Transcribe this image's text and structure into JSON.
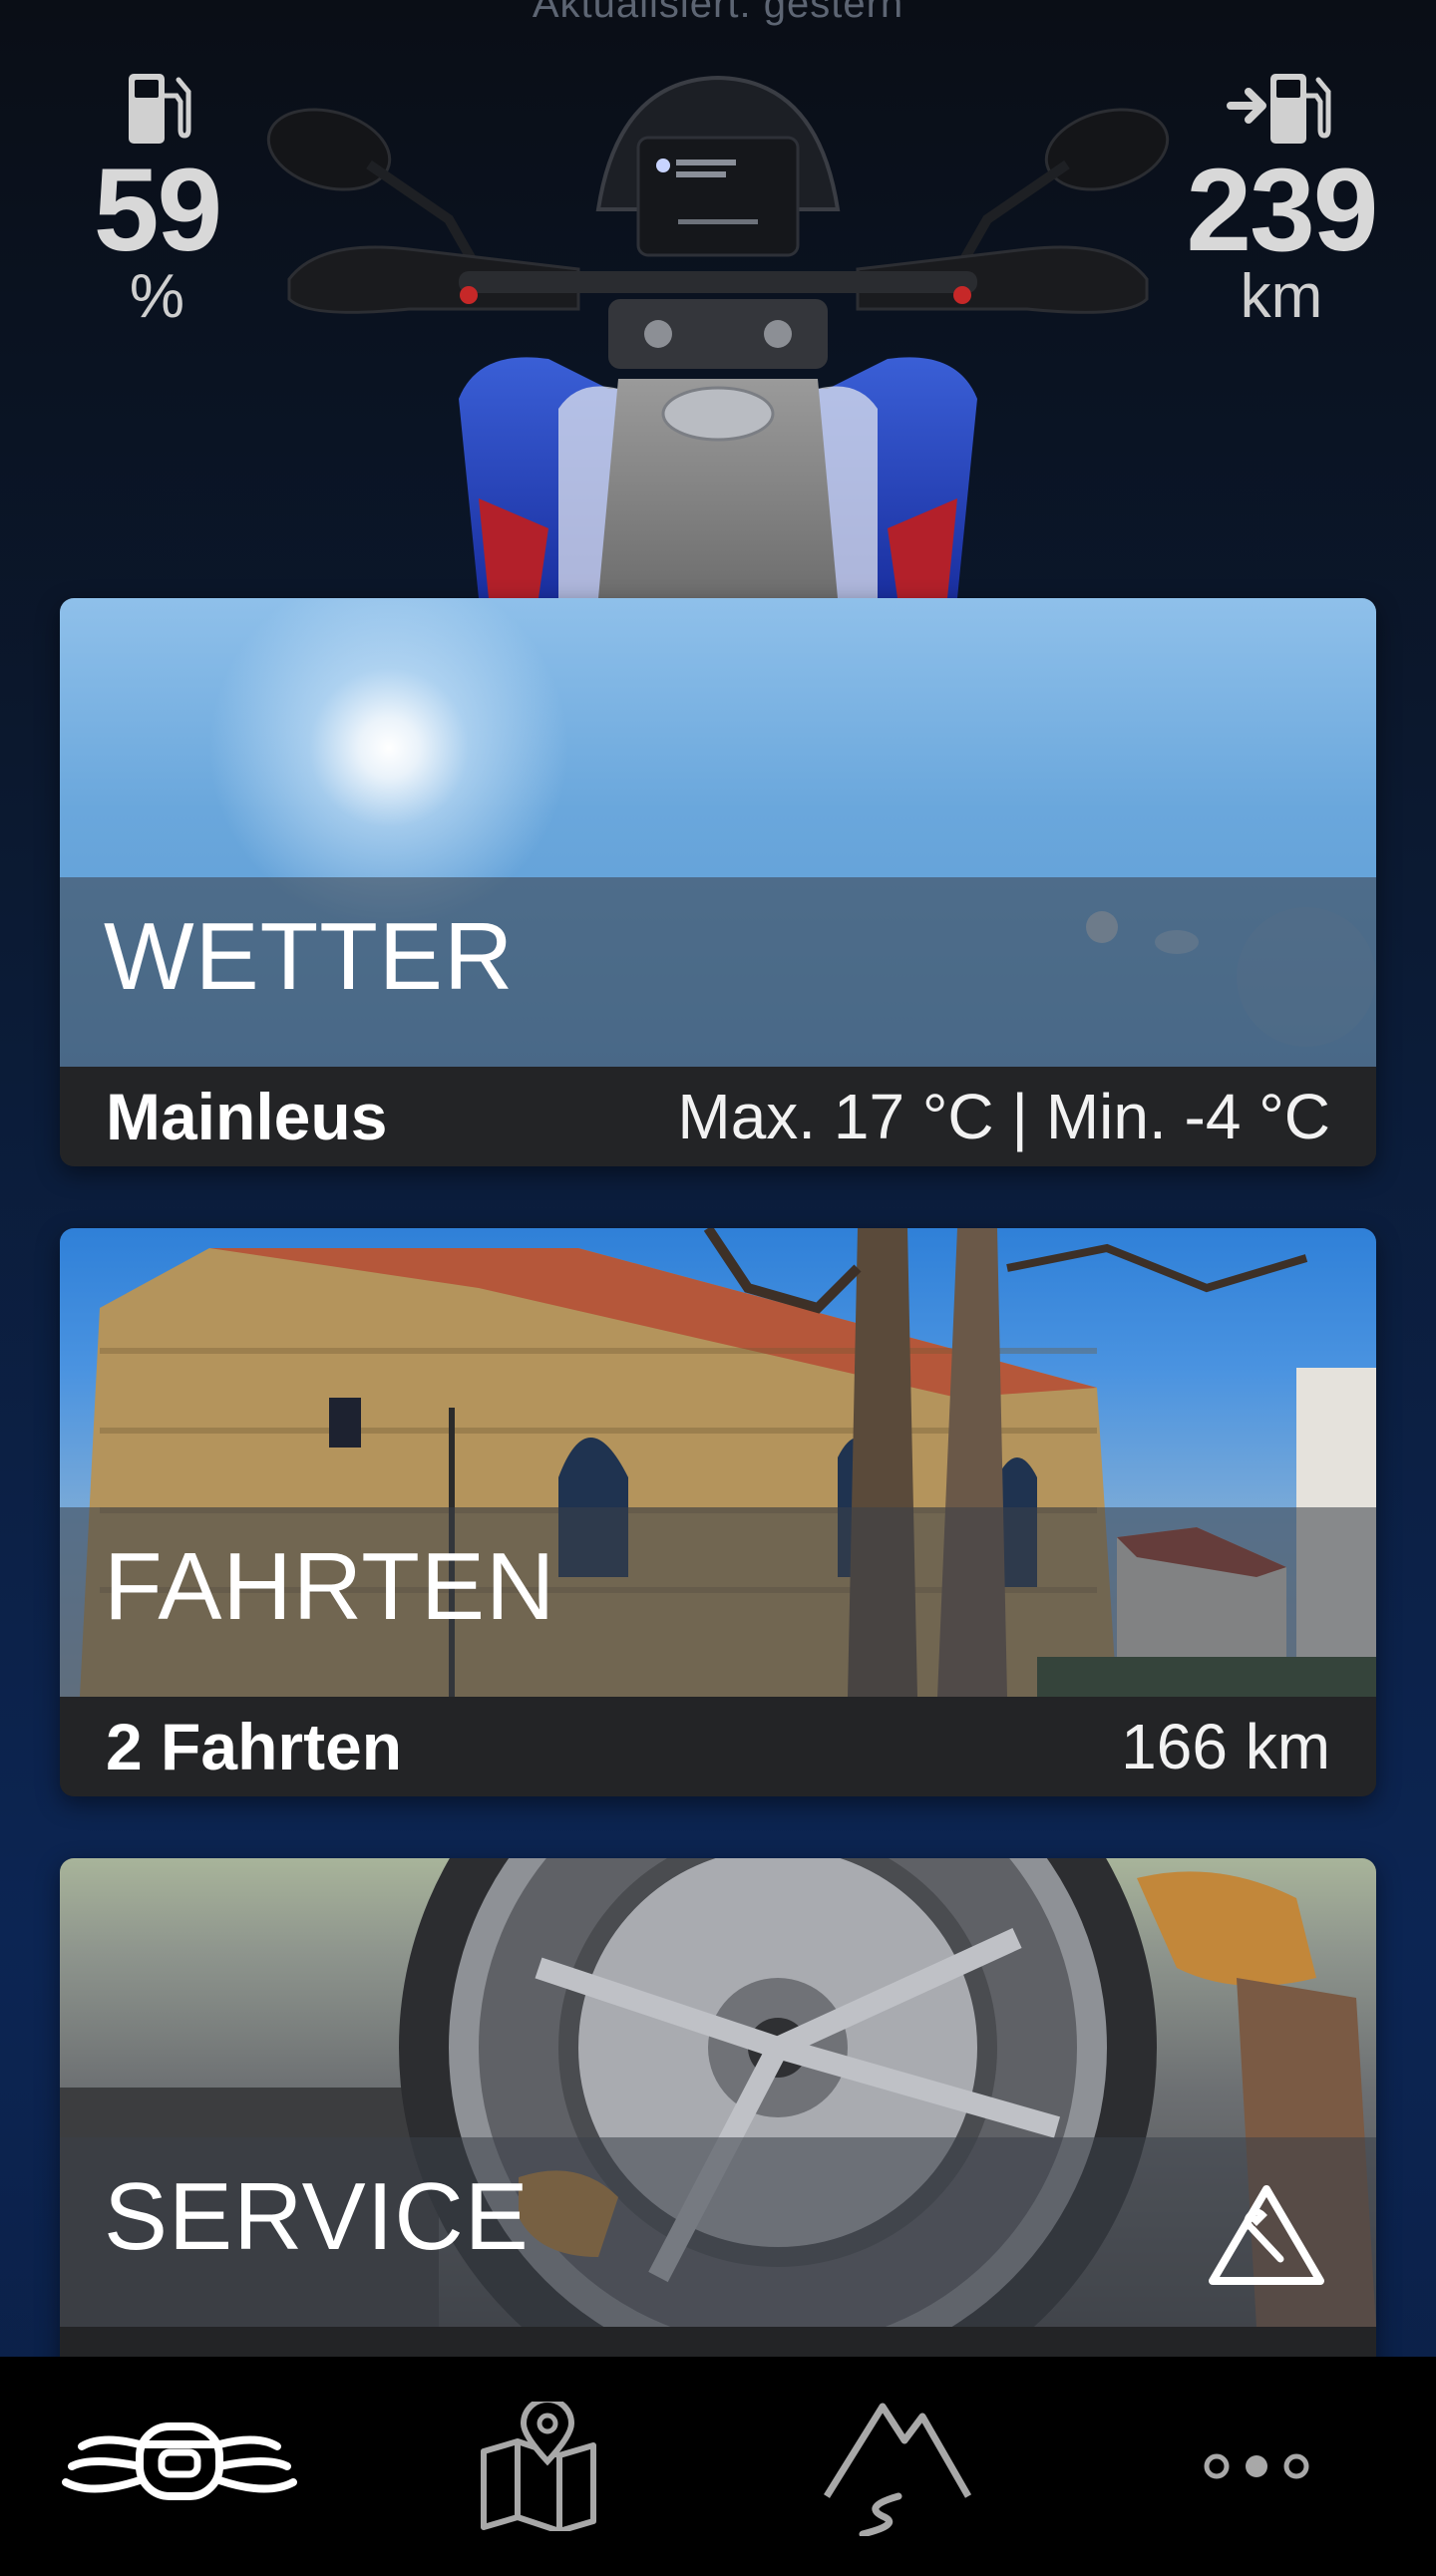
{
  "header": {
    "updated_text": "Aktualisiert: gestern"
  },
  "fuel": {
    "icon": "fuel-pump-icon",
    "value": "59",
    "unit": "%"
  },
  "range": {
    "icon": "fuel-range-icon",
    "value": "239",
    "unit": "km"
  },
  "cards": {
    "weather": {
      "title": "WETTER",
      "location": "Mainleus",
      "temps": "Max. 17 °C | Min. -4 °C"
    },
    "trips": {
      "title": "FAHRTEN",
      "count": "2 Fahrten",
      "distance": "166 km"
    },
    "service": {
      "title": "SERVICE",
      "icon": "service-warning-icon"
    }
  },
  "nav": {
    "items": [
      {
        "name": "vehicle",
        "icon": "motorcycle-handlebar-icon",
        "active": true
      },
      {
        "name": "map",
        "icon": "map-pin-icon",
        "active": false
      },
      {
        "name": "routes",
        "icon": "mountain-route-icon",
        "active": false
      },
      {
        "name": "more",
        "icon": "more-dots-icon",
        "active": false
      }
    ]
  },
  "colors": {
    "background_top": "#0a0e16",
    "background_bottom": "#0c2553",
    "card_footer": "#232426",
    "nav_bar": "#000000"
  }
}
